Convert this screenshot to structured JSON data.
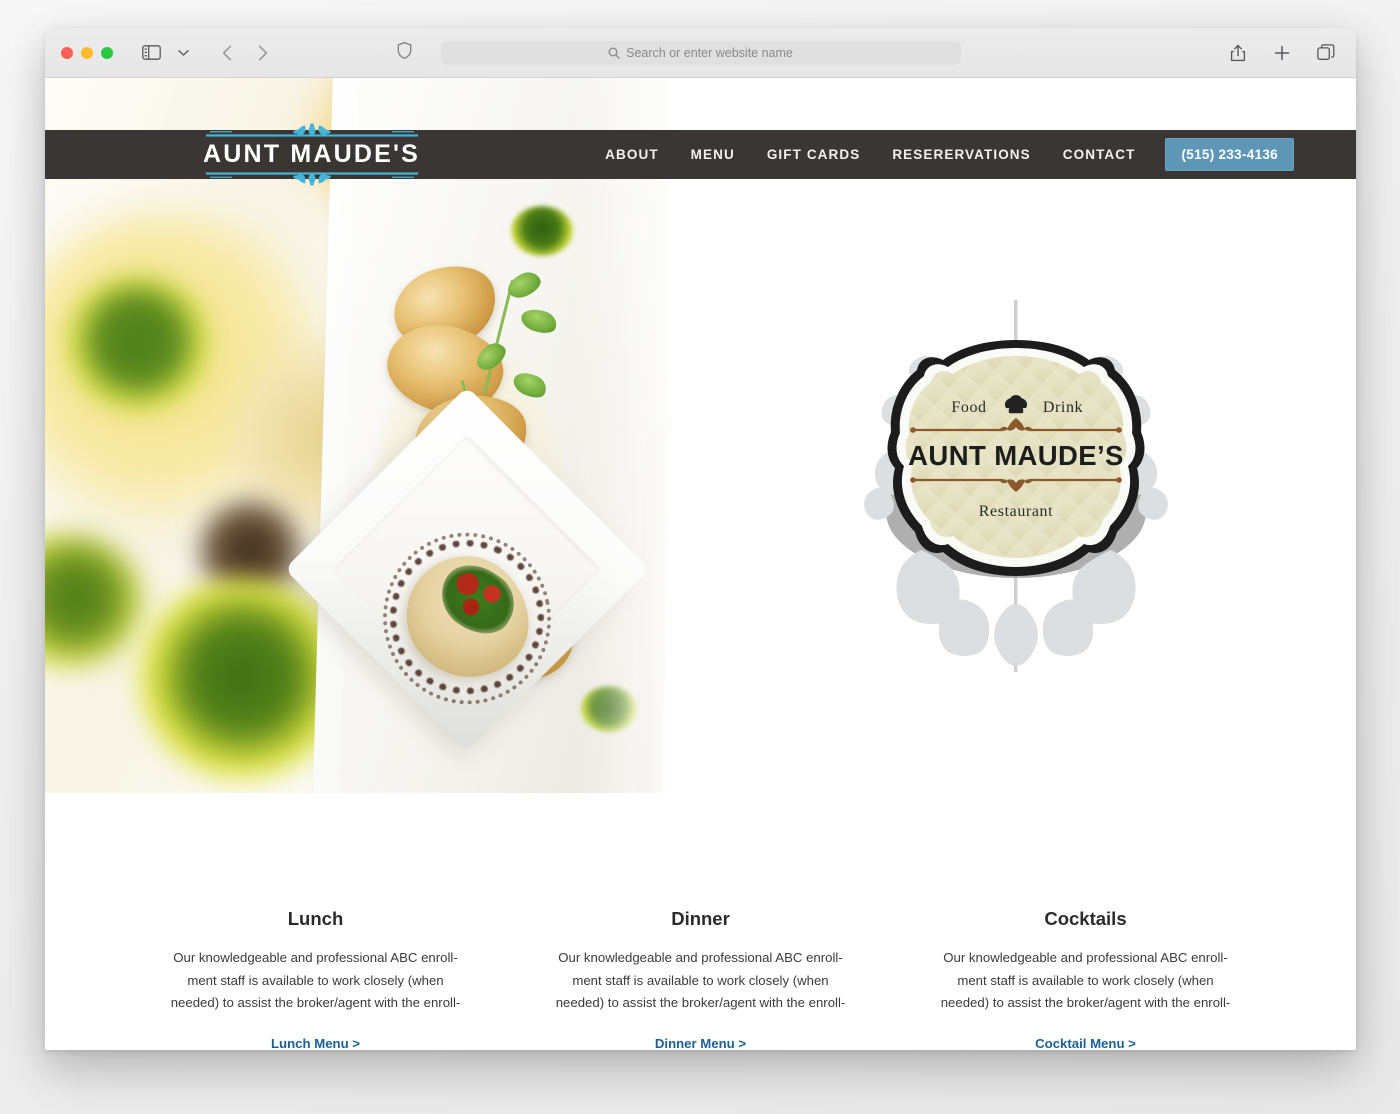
{
  "browser": {
    "name": "Safari",
    "traffic_lights": [
      "close",
      "minimize",
      "maximize"
    ],
    "sidebar_toggle_label": "Show sidebar",
    "tab_overview_label": "Tab overview",
    "back_label": "Back",
    "forward_label": "Forward",
    "share_label": "Share",
    "new_tab_label": "New tab",
    "address": {
      "value": "",
      "placeholder": "Search or enter website name"
    }
  },
  "site": {
    "brand": "AUNT MAUDE'S",
    "nav": [
      {
        "label": "ABOUT"
      },
      {
        "label": "MENU"
      },
      {
        "label": "GIFT CARDS"
      },
      {
        "label": "RESERERVATIONS"
      },
      {
        "label": "CONTACT"
      }
    ],
    "phone": "(515) 233-4136",
    "colors": {
      "nav_background": "#2a2725",
      "phone_button": "#5e96b6",
      "brand_flourish": "#46b4d8",
      "link": "#1a5f96",
      "emblem_fill": "#e6e3c8",
      "emblem_rule": "#8a5a2b"
    },
    "emblem": {
      "food": "Food",
      "drink": "Drink",
      "name": "AUNT MAUDE'S",
      "type": "Restaurant",
      "center_icon": "chef-hat-icon"
    },
    "cards": [
      {
        "title": "Lunch",
        "body": "Our  knowledgeable and professional ABC enroll-ment staff is available to work closely (when needed) to assist the broker/agent with the enroll-",
        "link": "Lunch Menu >"
      },
      {
        "title": "Dinner",
        "body": "Our  knowledgeable and professional ABC enroll-ment staff is available to work closely (when needed) to assist the broker/agent with the enroll-",
        "link": "Dinner Menu >"
      },
      {
        "title": "Cocktails",
        "body": "Our  knowledgeable and professional ABC enroll-ment staff is available to work closely (when needed) to assist the broker/agent with the enroll-",
        "link": "Cocktail Menu >"
      }
    ],
    "hero_image_alt": "Plated scallops with herb oil and a diamond-set ravioli"
  }
}
